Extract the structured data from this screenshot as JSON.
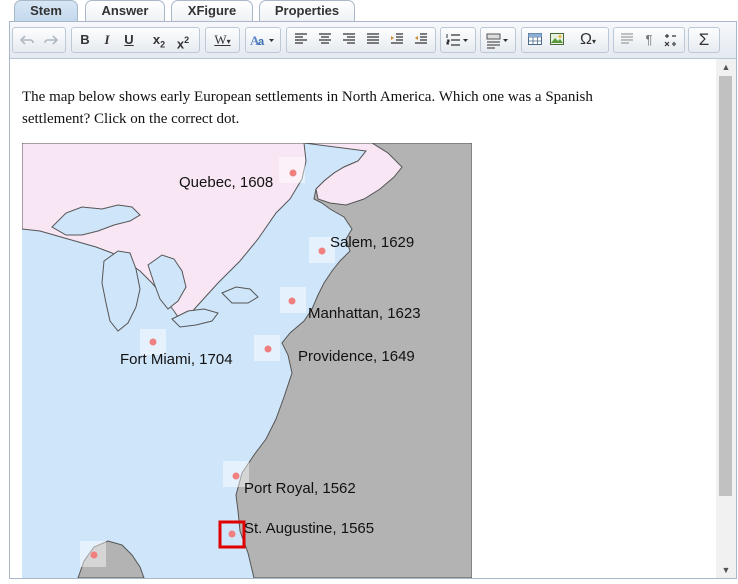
{
  "tabs": [
    {
      "label": "Stem",
      "active": true
    },
    {
      "label": "Answer",
      "active": false
    },
    {
      "label": "XFigure",
      "active": false
    },
    {
      "label": "Properties",
      "active": false
    }
  ],
  "toolbar": {
    "bold": "B",
    "italic": "I",
    "underline": "U",
    "subscript": "x",
    "subscript_mark": "2",
    "superscript": "x",
    "superscript_mark": "2",
    "word_style": "W",
    "omega": "Ω",
    "pilcrow": "¶",
    "sigma": "Σ"
  },
  "stem": {
    "question": "The map below shows early European settlements in North America. Which one was a Spanish settlement? Click on the correct dot."
  },
  "map": {
    "colors": {
      "ocean": "#cfe5fa",
      "land": "#b3b3b3",
      "canada": "#f8e6f4",
      "dot": "#f08080",
      "selected": "#e00000"
    },
    "settlements": [
      {
        "label": "Quebec, 1608"
      },
      {
        "label": "Salem, 1629"
      },
      {
        "label": "Manhattan, 1623"
      },
      {
        "label": "Fort Miami, 1704"
      },
      {
        "label": "Providence, 1649"
      },
      {
        "label": "Port Royal, 1562"
      },
      {
        "label": "St. Augustine, 1565",
        "selected": true
      }
    ]
  }
}
